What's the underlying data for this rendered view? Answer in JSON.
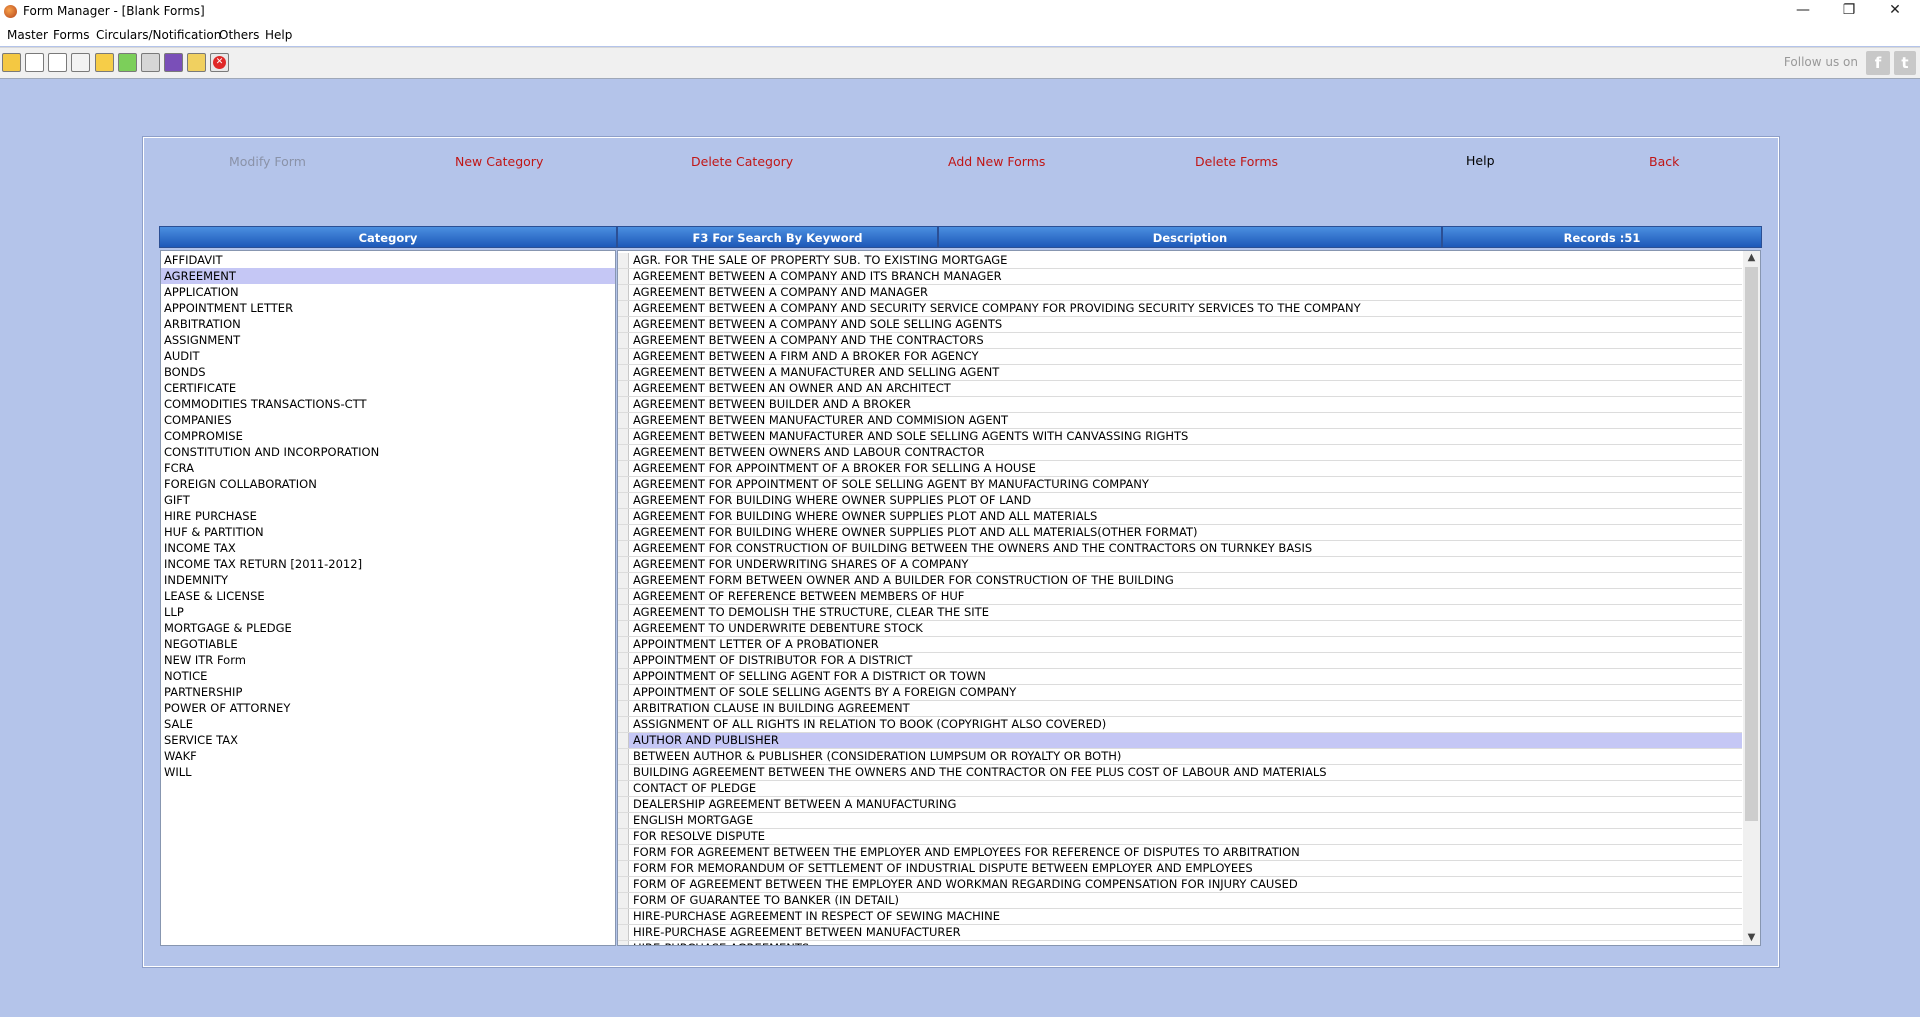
{
  "window": {
    "title": "Form Manager - [Blank Forms]",
    "controls": {
      "minimize": "—",
      "restore": "❐",
      "close": "✕"
    }
  },
  "menu": [
    {
      "label": "Master"
    },
    {
      "label": "Forms"
    },
    {
      "label": "Circulars/Notification"
    },
    {
      "label": "Others"
    },
    {
      "label": "Help"
    }
  ],
  "toolbar": {
    "icons": [
      "users-icon",
      "form-icon",
      "form-edit-icon",
      "notepad-icon",
      "folder-icon",
      "chart-icon",
      "tools-icon",
      "book-icon",
      "help-book-icon",
      "exit-icon"
    ],
    "follow_label": "Follow us on",
    "social": [
      "f",
      "t"
    ]
  },
  "actions": {
    "modify": "Modify Form",
    "new_category": "New Category",
    "delete_category": "Delete Category",
    "add_forms": "Add New Forms",
    "delete_forms": "Delete Forms",
    "help": "Help",
    "back": "Back"
  },
  "headers": {
    "category": "Category",
    "search": "F3 For Search By Keyword",
    "description": "Description",
    "records": "Records :51"
  },
  "categories": [
    "AFFIDAVIT",
    "AGREEMENT",
    "APPLICATION",
    "APPOINTMENT LETTER",
    "ARBITRATION",
    "ASSIGNMENT",
    "AUDIT",
    "BONDS",
    "CERTIFICATE",
    "COMMODITIES TRANSACTIONS-CTT",
    "COMPANIES",
    "COMPROMISE",
    "CONSTITUTION AND INCORPORATION",
    "FCRA",
    "FOREIGN COLLABORATION",
    "GIFT",
    "HIRE PURCHASE",
    "HUF & PARTITION",
    "INCOME TAX",
    "INCOME TAX RETURN [2011-2012]",
    "INDEMNITY",
    "LEASE & LICENSE",
    "LLP",
    "MORTGAGE & PLEDGE",
    "NEGOTIABLE",
    "NEW ITR Form",
    "NOTICE",
    "PARTNERSHIP",
    "POWER OF ATTORNEY",
    "SALE",
    "SERVICE TAX",
    "WAKF",
    "WILL"
  ],
  "selected_category": "AGREEMENT",
  "forms": [
    "AGR. FOR THE SALE OF PROPERTY SUB. TO EXISTING MORTGAGE",
    "AGREEMENT BETWEEN A COMPANY AND ITS BRANCH MANAGER",
    "AGREEMENT BETWEEN A COMPANY AND MANAGER",
    "AGREEMENT BETWEEN A COMPANY AND SECURITY SERVICE COMPANY FOR PROVIDING SECURITY SERVICES TO THE COMPANY",
    "AGREEMENT BETWEEN A COMPANY AND SOLE SELLING AGENTS",
    "AGREEMENT BETWEEN A COMPANY AND THE CONTRACTORS",
    "AGREEMENT BETWEEN A FIRM AND A BROKER FOR AGENCY",
    "AGREEMENT BETWEEN A MANUFACTURER AND SELLING AGENT",
    "AGREEMENT BETWEEN AN OWNER AND AN ARCHITECT",
    "AGREEMENT BETWEEN BUILDER AND A BROKER",
    "AGREEMENT BETWEEN MANUFACTURER AND COMMISION AGENT",
    "AGREEMENT BETWEEN MANUFACTURER AND SOLE SELLING AGENTS WITH CANVASSING RIGHTS",
    "AGREEMENT BETWEEN OWNERS AND LABOUR CONTRACTOR",
    "AGREEMENT FOR APPOINTMENT OF A BROKER FOR SELLING A HOUSE",
    "AGREEMENT FOR APPOINTMENT OF SOLE SELLING AGENT BY MANUFACTURING  COMPANY",
    "AGREEMENT FOR BUILDING WHERE  OWNER SUPPLIES PLOT OF LAND",
    "AGREEMENT FOR BUILDING WHERE OWNER SUPPLIES PLOT AND ALL MATERIALS",
    "AGREEMENT FOR BUILDING WHERE OWNER SUPPLIES PLOT AND ALL MATERIALS(OTHER FORMAT)",
    "AGREEMENT FOR CONSTRUCTION OF BUILDING BETWEEN THE OWNERS AND THE CONTRACTORS ON TURNKEY BASIS",
    "AGREEMENT FOR UNDERWRITING SHARES OF A COMPANY",
    "AGREEMENT FORM BETWEEN OWNER AND A BUILDER FOR CONSTRUCTION OF THE BUILDING",
    "AGREEMENT OF REFERENCE BETWEEN MEMBERS OF HUF",
    "AGREEMENT TO DEMOLISH THE STRUCTURE, CLEAR THE SITE",
    "AGREEMENT TO UNDERWRITE DEBENTURE STOCK",
    "APPOINTMENT LETTER OF A PROBATIONER",
    "APPOINTMENT OF DISTRIBUTOR FOR A DISTRICT",
    "APPOINTMENT OF SELLING AGENT FOR A DISTRICT OR TOWN",
    "APPOINTMENT OF SOLE SELLING AGENTS BY A FOREIGN COMPANY",
    "ARBITRATION CLAUSE IN BUILDING AGREEMENT",
    "ASSIGNMENT OF ALL RIGHTS IN RELATION TO  BOOK (COPYRIGHT ALSO COVERED)",
    "AUTHOR AND PUBLISHER",
    "BETWEEN AUTHOR &  PUBLISHER (CONSIDERATION LUMPSUM OR ROYALTY OR BOTH)",
    "BUILDING AGREEMENT BETWEEN THE OWNERS AND THE CONTRACTOR ON FEE PLUS COST OF LABOUR AND MATERIALS",
    "CONTACT OF PLEDGE",
    "DEALERSHIP AGREEMENT  BETWEEN A MANUFACTURING",
    "ENGLISH MORTGAGE",
    "FOR RESOLVE DISPUTE",
    "FORM FOR AGREEMENT BETWEEN THE EMPLOYER AND EMPLOYEES FOR REFERENCE OF DISPUTES TO ARBITRATION",
    "FORM FOR MEMORANDUM OF SETTLEMENT OF INDUSTRIAL DISPUTE BETWEEN  EMPLOYER AND EMPLOYEES",
    "FORM OF AGREEMENT BETWEEN THE EMPLOYER AND WORKMAN REGARDING COMPENSATION FOR INJURY CAUSED",
    "FORM OF GUARANTEE TO BANKER (IN DETAIL)",
    "HIRE-PURCHASE  AGREEMENT IN RESPECT OF SEWING MACHINE",
    "HIRE-PURCHASE AGREEMENT  BETWEEN  MANUFACTURER",
    "HIRE-PURCHASE AGREEMENTS"
  ],
  "selected_form": "AUTHOR AND PUBLISHER"
}
